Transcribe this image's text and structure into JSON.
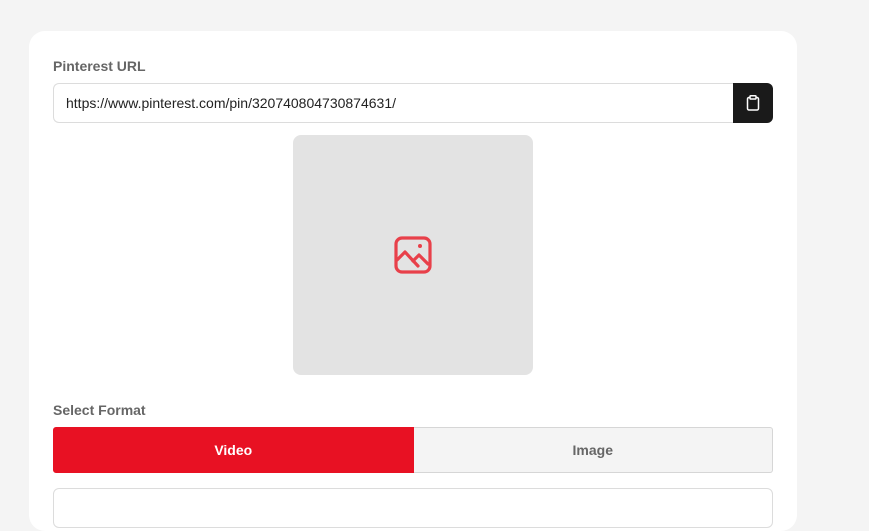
{
  "url_field": {
    "label": "Pinterest URL",
    "value": "https://www.pinterest.com/pin/320740804730874631/",
    "paste_icon": "clipboard-icon"
  },
  "preview": {
    "icon": "image-placeholder-icon",
    "icon_color": "#e8404a"
  },
  "format": {
    "label": "Select Format",
    "options": [
      {
        "label": "Video",
        "selected": true
      },
      {
        "label": "Image",
        "selected": false
      }
    ]
  },
  "colors": {
    "accent": "#e81123",
    "paste_button": "#1a1a1a"
  }
}
